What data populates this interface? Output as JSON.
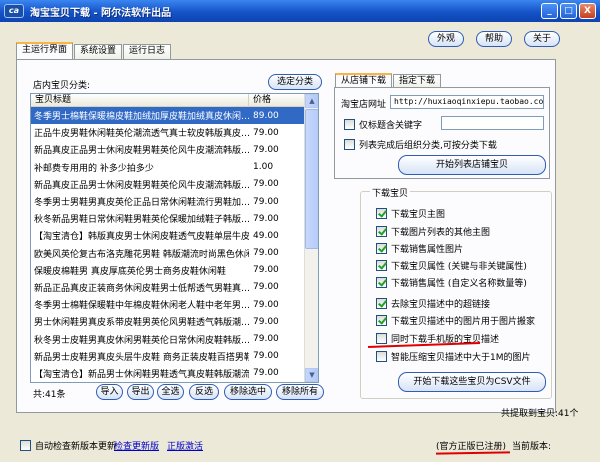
{
  "window": {
    "logo_text": "ca",
    "title": "淘宝宝贝下载 - 阿尔法软件出品",
    "min": "_",
    "max": "□",
    "close": "X"
  },
  "top_buttons": {
    "skin": "外观",
    "help": "帮助",
    "about": "关于"
  },
  "tabs": [
    "主运行界面",
    "系统设置",
    "运行日志"
  ],
  "left": {
    "category_label": "店内宝贝分类:",
    "select_category": "选定分类",
    "columns": [
      "宝贝标题",
      "价格"
    ],
    "rows": [
      {
        "title": "冬季男士棉鞋保暖棉皮鞋加绒加厚皮鞋加绒真皮休闲…",
        "price": "89.00"
      },
      {
        "title": "正品牛皮男鞋休闲鞋英伦潮流透气真士软皮韩版真皮…",
        "price": "79.00"
      },
      {
        "title": "新品真皮正品男士休闲皮鞋男鞋英伦风牛皮潮流韩版…",
        "price": "79.00"
      },
      {
        "title": "补邮费专用用的  补多少拍多少",
        "price": "1.00"
      },
      {
        "title": "新品真皮正品男士休闲皮鞋男鞋英伦风牛皮潮流韩版…",
        "price": "79.00"
      },
      {
        "title": "冬季男士男鞋男真皮英伦正品日常休闲鞋流行男鞋加…",
        "price": "79.00"
      },
      {
        "title": "秋冬新品男鞋日常休闲鞋男鞋英伦保暖加绒鞋子韩版…",
        "price": "79.00"
      },
      {
        "title": "【淘宝清仓】韩版真皮男士休闲皮鞋透气皮鞋单层牛皮…",
        "price": "49.00"
      },
      {
        "title": "欧美风英伦复古布洛克雕花男鞋 韩版潮流时尚黑色休闲…",
        "price": "79.00"
      },
      {
        "title": "保暖皮棉鞋男 真皮厚底英伦男士商务皮鞋休闲鞋",
        "price": "79.00"
      },
      {
        "title": "新品正品真皮正装商务休闲皮鞋男士低帮透气男鞋真…",
        "price": "79.00"
      },
      {
        "title": "冬季男士棉鞋保暖鞋中年棉皮鞋休闲老人鞋中老年男…",
        "price": "79.00"
      },
      {
        "title": "男士休闲鞋男真皮系带皮鞋男英伦风男鞋透气韩版潮…",
        "price": "79.00"
      },
      {
        "title": "秋冬男士皮鞋男真皮休闲男鞋英伦日常休闲皮鞋韩版…",
        "price": "79.00"
      },
      {
        "title": "新品男士皮鞋男真皮头层牛皮鞋 商务正装皮鞋百搭男鞋",
        "price": "79.00"
      },
      {
        "title": "【淘宝清仓】新品男士休闲鞋男鞋透气真皮鞋韩版潮流…",
        "price": "79.00"
      }
    ],
    "count": "共:41条",
    "actions": [
      "导入",
      "导出",
      "全选",
      "反选",
      "移除选中",
      "移除所有"
    ]
  },
  "shop_panel": {
    "tabs": [
      "从店铺下载",
      "指定下载"
    ],
    "url_label": "淘宝店网址",
    "url_value": "http://huxiaoqinxiepu.taobao.com",
    "keyword_label": "仅标题含关键字",
    "list_done_label": "列表完成后组织分类,可按分类下载",
    "start_list": "开始列表店铺宝贝"
  },
  "download": {
    "group_title": "下载宝贝",
    "options": [
      {
        "label": "下载宝贝主图",
        "checked": true
      },
      {
        "label": "下载图片列表的其他主图",
        "checked": true
      },
      {
        "label": "下载销售属性图片",
        "checked": true
      },
      {
        "label": "下载宝贝属性 (关键与非关键属性)",
        "checked": true
      },
      {
        "label": "下载销售属性 (自定义名称数量等)",
        "checked": true
      },
      {
        "label": "去除宝贝描述中的超链接",
        "checked": true
      },
      {
        "label": "下载宝贝描述中的图片用于图片搬家",
        "checked": true
      },
      {
        "label": "同时下载手机版的宝贝描述",
        "checked": false
      },
      {
        "label": "智能压缩宝贝描述中大于1M的图片",
        "checked": false
      }
    ],
    "start_csv": "开始下载这些宝贝为CSV文件",
    "total_label": "共提取到宝贝:41个"
  },
  "footer": {
    "auto_check": "自动检查新版本更新",
    "check_new": "检查更新版",
    "activate": "正版激活",
    "registered": "(官方正版已注册)",
    "current_version": "当前版本:"
  },
  "colors": {
    "title_bar": "#1453c8",
    "selection": "#316ac5",
    "link": "#0000cc",
    "annotation": "#e00000"
  }
}
